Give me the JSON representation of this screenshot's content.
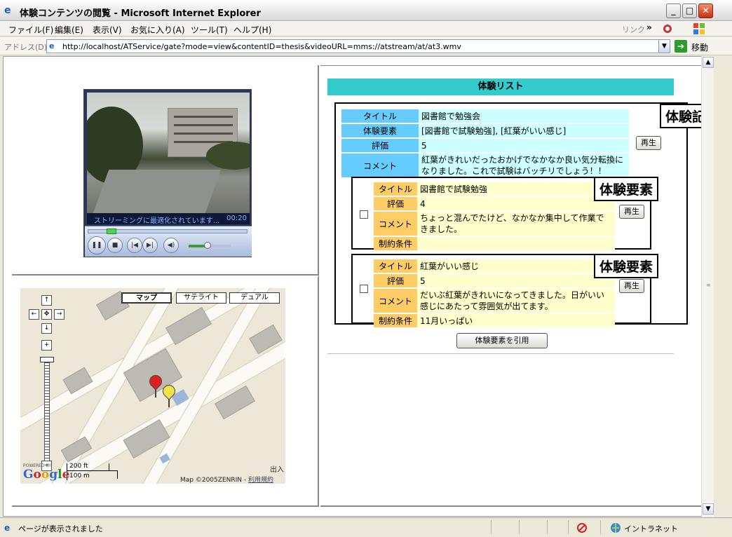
{
  "window": {
    "title": "体験コンテンツの閲覧 - Microsoft Internet Explorer",
    "minimize": "_",
    "maximize": "□",
    "close": "✕"
  },
  "menu": {
    "items": [
      "ファイル(F)",
      "編集(E)",
      "表示(V)",
      "お気に入り(A)",
      "ツール(T)",
      "ヘルプ(H)"
    ],
    "links": "リンク",
    "chevron": "»"
  },
  "address": {
    "label": "アドレス(D)",
    "url": "http://localhost/ATService/gate?mode=view&contentID=thesis&videoURL=mms://atstream/at/at3.wmv",
    "go": "移動"
  },
  "player": {
    "status": "ストリーミングに最適化されています...",
    "time": "00:20",
    "buttons": {
      "pause": "❚❚",
      "stop": "■",
      "prev": "|◀",
      "next": "▶|",
      "mute": "◀)"
    }
  },
  "map": {
    "types": [
      "マップ",
      "サテライト",
      "デュアル"
    ],
    "nav": {
      "up": "↑",
      "left": "←",
      "center": "✥",
      "right": "→",
      "down": "↓",
      "zoom_in": "+",
      "zoom_out": "−"
    },
    "scale_ft": "200 ft",
    "scale_m": "100 m",
    "powered": "POWERED BY",
    "logo": "Google",
    "copyright": "Map ©2005ZENRIN - ",
    "terms": "利用規約",
    "corner": "出入"
  },
  "list": {
    "header": "体験リスト",
    "record_callout": "体験記録",
    "element_callout": "体験要素",
    "record": {
      "rows": [
        {
          "key": "タイトル",
          "value": "図書館で勉強会"
        },
        {
          "key": "体験要素",
          "value": "[図書館で試験勉強], [紅葉がいい感じ]"
        },
        {
          "key": "評価",
          "value": "5"
        },
        {
          "key": "コメント",
          "value": "紅葉がきれいだったおかげでなかなか良い気分転換になりました。これで試験はバッチリでしょう！！"
        }
      ],
      "play": "再生"
    },
    "elements": [
      {
        "rows": [
          {
            "key": "タイトル",
            "value": "図書館で試験勉強"
          },
          {
            "key": "評価",
            "value": "4"
          },
          {
            "key": "コメント",
            "value": "ちょっと混んでたけど、なかなか集中して作業できました。"
          },
          {
            "key": "制約条件",
            "value": ""
          }
        ],
        "play": "再生"
      },
      {
        "rows": [
          {
            "key": "タイトル",
            "value": "紅葉がいい感じ"
          },
          {
            "key": "評価",
            "value": "5"
          },
          {
            "key": "コメント",
            "value": "だいぶ紅葉がきれいになってきました。日がいい感じにあたって雰囲気が出てます。"
          },
          {
            "key": "制約条件",
            "value": "11月いっぱい"
          }
        ],
        "play": "再生"
      }
    ],
    "quote_button": "体験要素を引用"
  },
  "status": {
    "text": "ページが表示されました",
    "zone": "イントラネット"
  }
}
